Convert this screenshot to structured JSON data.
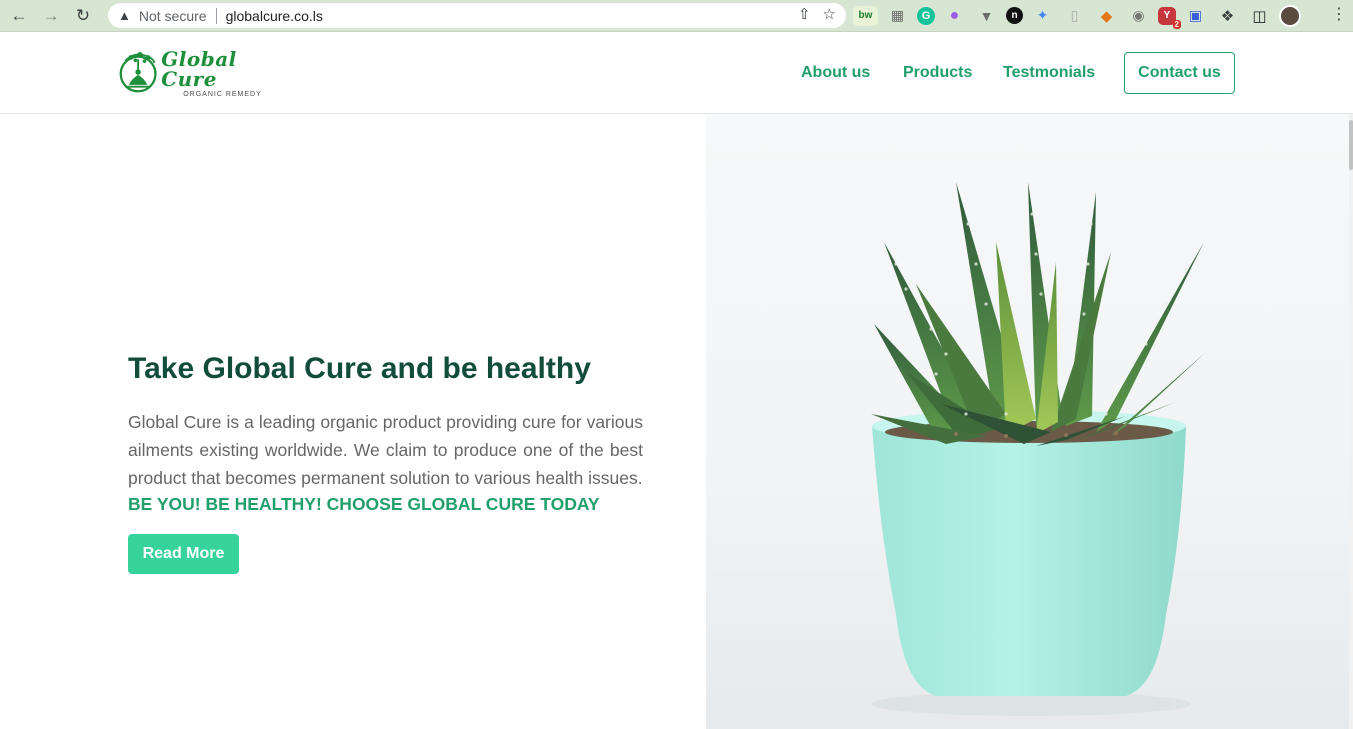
{
  "browser": {
    "security_label": "Not secure",
    "url": "globalcure.co.ls",
    "extensions": [
      "bw",
      "grammarly",
      "dropper",
      "vimium",
      "notion",
      "magic",
      "phone",
      "metamask",
      "camera",
      "youtube",
      "screen",
      "puzzle"
    ],
    "extension_badge": "2",
    "ext_bw": "bw",
    "ext_notion": "n"
  },
  "logo": {
    "name": "Global Cure",
    "tagline": "ORGANIC REMEDY"
  },
  "nav": {
    "about": "About us",
    "products": "Products",
    "testimonials": "Testmonials",
    "contact": "Contact us"
  },
  "hero": {
    "title": "Take Global Cure and be healthy",
    "description": "Global Cure is a leading organic product providing cure for various ailments existing worldwide. We claim to produce one of the best product that becomes permanent solution to various health issues.",
    "tagline": "BE YOU! BE HEALTHY! CHOOSE GLOBAL CURE TODAY",
    "button": "Read More"
  },
  "colors": {
    "brand_green": "#22a06b",
    "title_dark": "#124d3c",
    "button_green": "#37d39b",
    "pot_mint": "#a7eee2"
  }
}
